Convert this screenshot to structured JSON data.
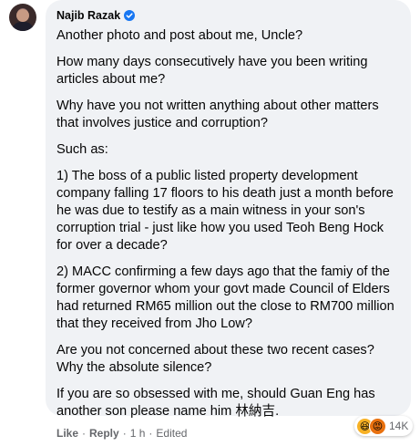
{
  "comment": {
    "author": "Najib Razak",
    "paragraphs": [
      "Another photo and post about me, Uncle?",
      "How many days consecutively have you been writing articles about me?",
      "Why have you not written anything about other matters that involves justice and corruption?",
      "Such as:",
      "1) The boss of a public listed property development company falling 17 floors to his death just a month before he was due to testify as a main witness in your son's corruption trial - just like how you used Teoh Beng Hock for over a decade?",
      "2) MACC confirming a few days ago that the famiy of the former governor whom your govt made Council of Elders had returned RM65 million out the close to RM700 million that they received from Jho Low?",
      "Are you not concerned about these two recent cases? Why the absolute silence?",
      "If you are so obsessed with me, should Guan Eng has another son please name him 林納吉."
    ]
  },
  "actions": {
    "like": "Like",
    "reply": "Reply",
    "time": "1 h",
    "edited": "Edited",
    "separator": "·"
  },
  "reactions": {
    "icons": [
      "haha-reaction-icon",
      "angry-reaction-icon"
    ],
    "count": "14K"
  },
  "colors": {
    "bubble": "#f0f2f5",
    "verified": "#1877f2",
    "secondary_text": "#65676b"
  }
}
